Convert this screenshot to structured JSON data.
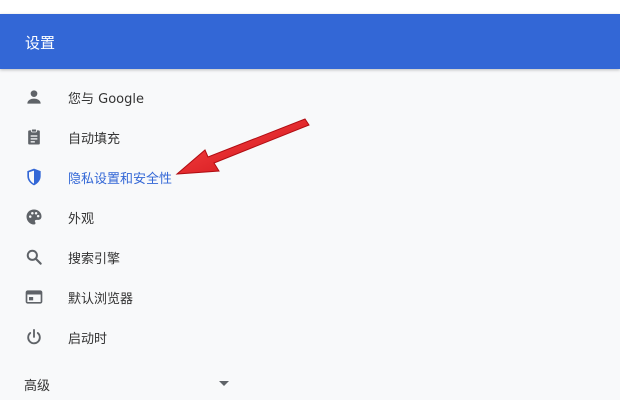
{
  "header": {
    "title": "设置"
  },
  "menu": {
    "items": [
      {
        "label": "您与 Google",
        "icon": "person-icon"
      },
      {
        "label": "自动填充",
        "icon": "clipboard-icon"
      },
      {
        "label": "隐私设置和安全性",
        "icon": "shield-icon",
        "active": true
      },
      {
        "label": "外观",
        "icon": "palette-icon"
      },
      {
        "label": "搜索引擎",
        "icon": "search-icon"
      },
      {
        "label": "默认浏览器",
        "icon": "browser-window-icon"
      },
      {
        "label": "启动时",
        "icon": "power-icon"
      }
    ]
  },
  "advanced": {
    "label": "高级",
    "icon": "chevron-down-icon"
  },
  "annotation": {
    "icon": "red-arrow-icon",
    "color": "#e8141a"
  },
  "colors": {
    "header_bg": "#3367d6",
    "active_text": "#3367d6",
    "icon": "#5f6368",
    "page_bg": "#f8f9fa"
  }
}
